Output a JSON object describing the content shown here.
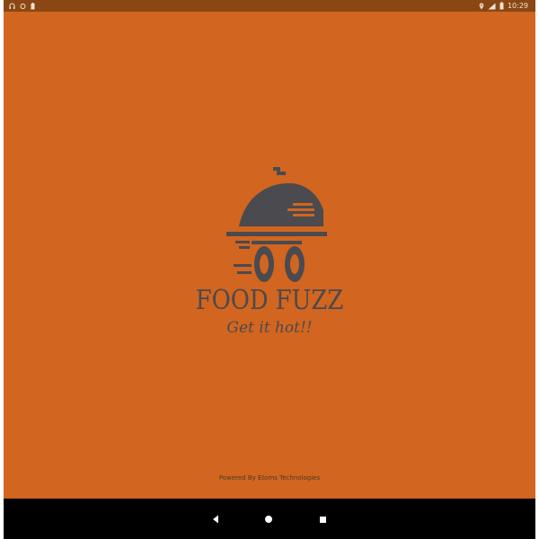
{
  "status_bar": {
    "time": "10:29",
    "left_icons": [
      "headset-icon",
      "sync-icon",
      "battery-saver-icon"
    ],
    "right_icons": [
      "location-icon",
      "signal-icon",
      "battery-icon"
    ]
  },
  "splash": {
    "title": "FOOD FUZZ",
    "tagline": "Get it hot!!",
    "powered_by": "Powered By Etoms Technologies",
    "logo_icon": "food-delivery-cart-icon"
  },
  "navigation": {
    "back_icon": "back-icon",
    "home_icon": "home-icon",
    "recents_icon": "recents-icon"
  },
  "colors": {
    "background": "#d2651f",
    "status_bar": "#8a4714",
    "brand_text": "#4a4a4f",
    "nav_bar": "#000000"
  }
}
